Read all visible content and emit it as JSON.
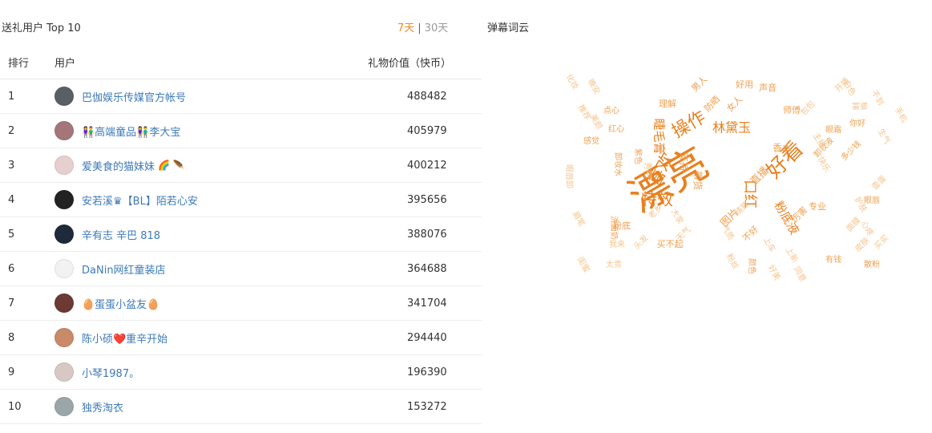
{
  "left": {
    "title": "送礼用户 Top 10",
    "tabs": [
      {
        "label": "7天",
        "active": true
      },
      {
        "label": "30天",
        "active": false
      }
    ],
    "separator": "|",
    "columns": {
      "rank": "排行",
      "user": "用户",
      "value": "礼物价值（快币）"
    },
    "rows": [
      {
        "rank": "1",
        "name": "巴伽娱乐传媒官方帐号",
        "value": "488482",
        "tail": "",
        "avatar": "#5a5f66"
      },
      {
        "rank": "2",
        "name": "👫高端童品👫李大宝",
        "value": "405979",
        "tail": "",
        "avatar": "#a4767a"
      },
      {
        "rank": "3",
        "name": "爱美食的猫妹妹",
        "value": "400212",
        "tail": "🌈 🪶",
        "avatar": "#e8cfcf"
      },
      {
        "rank": "4",
        "name": "安若溪♛【BL】陌若心安",
        "value": "395656",
        "tail": "",
        "avatar": "#222222"
      },
      {
        "rank": "5",
        "name": "辛有志 辛巴 818",
        "value": "388076",
        "tail": "",
        "avatar": "#1e2a3a"
      },
      {
        "rank": "6",
        "name": "DaNin网红童装店",
        "value": "364688",
        "tail": "",
        "avatar": "#f2f2f2"
      },
      {
        "rank": "7",
        "name": "🥚蛋蛋小盆友🥚",
        "value": "341704",
        "tail": "",
        "avatar": "#6b3a33"
      },
      {
        "rank": "8",
        "name": "陈小硕❤️重辛开始",
        "value": "294440",
        "tail": "",
        "avatar": "#c98a6a"
      },
      {
        "rank": "9",
        "name": "小琴1987。",
        "value": "196390",
        "tail": "",
        "avatar": "#d8c8c4"
      },
      {
        "rank": "10",
        "name": "独秀淘衣",
        "value": "153272",
        "tail": "",
        "avatar": "#9aa6a8"
      }
    ]
  },
  "right": {
    "title": "弹幕词云",
    "colors": {
      "strong": "#e8801f",
      "mid": "#f0a050",
      "light": "#f5c58e"
    },
    "words": [
      {
        "text": "漂亮",
        "size": 52,
        "color": "strong",
        "rotate": -30
      },
      {
        "text": "好看",
        "size": 26,
        "color": "strong",
        "rotate": -45
      },
      {
        "text": "操作",
        "size": 22,
        "color": "strong",
        "rotate": -30
      },
      {
        "text": "喜欢",
        "size": 22,
        "color": "strong",
        "rotate": -60
      },
      {
        "text": "特效",
        "size": 20,
        "color": "strong",
        "rotate": 0
      },
      {
        "text": "口红",
        "size": 18,
        "color": "strong",
        "rotate": 90
      },
      {
        "text": "林黛玉",
        "size": 16,
        "color": "strong",
        "rotate": 0
      },
      {
        "text": "睫毛膏",
        "size": 15,
        "color": "strong",
        "rotate": 90
      },
      {
        "text": "粉底液",
        "size": 15,
        "color": "strong",
        "rotate": 60
      },
      {
        "text": "直播",
        "size": 13,
        "color": "mid",
        "rotate": -45
      },
      {
        "text": "图片",
        "size": 13,
        "color": "mid",
        "rotate": -45
      },
      {
        "text": "香水",
        "size": 12,
        "color": "mid",
        "rotate": 0
      },
      {
        "text": "声音",
        "size": 11,
        "color": "mid",
        "rotate": 0
      },
      {
        "text": "好用",
        "size": 11,
        "color": "mid",
        "rotate": 0
      },
      {
        "text": "师傅",
        "size": 11,
        "color": "mid",
        "rotate": 0
      },
      {
        "text": "女人",
        "size": 11,
        "color": "mid",
        "rotate": -45
      },
      {
        "text": "男人",
        "size": 11,
        "color": "mid",
        "rotate": -45
      },
      {
        "text": "防晒",
        "size": 11,
        "color": "mid",
        "rotate": -45
      },
      {
        "text": "理解",
        "size": 11,
        "color": "mid",
        "rotate": 0
      },
      {
        "text": "支持",
        "size": 12,
        "color": "mid",
        "rotate": 90
      },
      {
        "text": "带货",
        "size": 12,
        "color": "mid",
        "rotate": 90
      },
      {
        "text": "专业",
        "size": 11,
        "color": "mid",
        "rotate": 0
      },
      {
        "text": "厉害",
        "size": 11,
        "color": "mid",
        "rotate": -45
      },
      {
        "text": "不好",
        "size": 11,
        "color": "mid",
        "rotate": -45
      },
      {
        "text": "买不起",
        "size": 11,
        "color": "mid",
        "rotate": 0
      },
      {
        "text": "粉底",
        "size": 11,
        "color": "mid",
        "rotate": 0
      },
      {
        "text": "感觉",
        "size": 10,
        "color": "mid",
        "rotate": 0
      },
      {
        "text": "红心",
        "size": 10,
        "color": "mid",
        "rotate": 0
      },
      {
        "text": "点心",
        "size": 10,
        "color": "mid",
        "rotate": 0
      },
      {
        "text": "有钱",
        "size": 10,
        "color": "mid",
        "rotate": 0
      },
      {
        "text": "散粉",
        "size": 10,
        "color": "mid",
        "rotate": 0
      },
      {
        "text": "眼霜",
        "size": 10,
        "color": "mid",
        "rotate": 0
      },
      {
        "text": "你好",
        "size": 10,
        "color": "mid",
        "rotate": 0
      },
      {
        "text": "眼唇",
        "size": 10,
        "color": "mid",
        "rotate": 0
      },
      {
        "text": "卸妆液",
        "size": 10,
        "color": "mid",
        "rotate": -45
      },
      {
        "text": "多少钱",
        "size": 10,
        "color": "mid",
        "rotate": -45
      },
      {
        "text": "卸妆水",
        "size": 10,
        "color": "mid",
        "rotate": 90
      },
      {
        "text": "洗面奶",
        "size": 10,
        "color": "mid",
        "rotate": 90
      },
      {
        "text": "紫色",
        "size": 10,
        "color": "mid",
        "rotate": 90
      },
      {
        "text": "颜色",
        "size": 10,
        "color": "mid",
        "rotate": 90
      },
      {
        "text": "秀吧",
        "size": 10,
        "color": "light",
        "rotate": 90
      },
      {
        "text": "精致",
        "size": 10,
        "color": "light",
        "rotate": -45
      },
      {
        "text": "太贵",
        "size": 10,
        "color": "light",
        "rotate": 0
      },
      {
        "text": "我来",
        "size": 10,
        "color": "light",
        "rotate": 0
      },
      {
        "text": "头发",
        "size": 10,
        "color": "light",
        "rotate": -45
      },
      {
        "text": "老乡",
        "size": 10,
        "color": "light",
        "rotate": -45
      },
      {
        "text": "天气",
        "size": 10,
        "color": "light",
        "rotate": -45
      },
      {
        "text": "包包",
        "size": 10,
        "color": "light",
        "rotate": -45
      },
      {
        "text": "开播",
        "size": 10,
        "color": "light",
        "rotate": -45
      },
      {
        "text": "白色",
        "size": 10,
        "color": "light",
        "rotate": 60
      },
      {
        "text": "不到",
        "size": 10,
        "color": "light",
        "rotate": 60
      },
      {
        "text": "富婆",
        "size": 10,
        "color": "light",
        "rotate": 0
      },
      {
        "text": "手机",
        "size": 10,
        "color": "light",
        "rotate": 60
      },
      {
        "text": "蛋蛋",
        "size": 10,
        "color": "light",
        "rotate": -45
      },
      {
        "text": "心疼",
        "size": 10,
        "color": "light",
        "rotate": 60
      },
      {
        "text": "眼唇卸",
        "size": 10,
        "color": "light",
        "rotate": 90
      },
      {
        "text": "面膜",
        "size": 10,
        "color": "light",
        "rotate": -45
      },
      {
        "text": "皮肤",
        "size": 10,
        "color": "light",
        "rotate": -45
      },
      {
        "text": "买买",
        "size": 10,
        "color": "light",
        "rotate": -45
      },
      {
        "text": "美颜",
        "size": 10,
        "color": "light",
        "rotate": 60
      },
      {
        "text": "化妆",
        "size": 10,
        "color": "light",
        "rotate": 60
      },
      {
        "text": "眉笔",
        "size": 10,
        "color": "light",
        "rotate": 60
      },
      {
        "text": "晚安",
        "size": 10,
        "color": "light",
        "rotate": 60
      },
      {
        "text": "闺蜜",
        "size": 10,
        "color": "light",
        "rotate": 60
      },
      {
        "text": "护肤",
        "size": 10,
        "color": "light",
        "rotate": 60
      },
      {
        "text": "推荐",
        "size": 10,
        "color": "light",
        "rotate": 60
      },
      {
        "text": "气质",
        "size": 10,
        "color": "light",
        "rotate": 60
      },
      {
        "text": "上车",
        "size": 10,
        "color": "light",
        "rotate": 60
      },
      {
        "text": "上新",
        "size": 10,
        "color": "light",
        "rotate": 60
      },
      {
        "text": "大家",
        "size": 10,
        "color": "light",
        "rotate": 60
      },
      {
        "text": "粉丝",
        "size": 10,
        "color": "light",
        "rotate": 60
      },
      {
        "text": "好美",
        "size": 10,
        "color": "light",
        "rotate": 60
      },
      {
        "text": "生气",
        "size": 10,
        "color": "light",
        "rotate": 60
      },
      {
        "text": "快乐",
        "size": 10,
        "color": "light",
        "rotate": 60
      },
      {
        "text": "同意",
        "size": 10,
        "color": "light",
        "rotate": 60
      },
      {
        "text": "主播",
        "size": 10,
        "color": "light",
        "rotate": 60
      }
    ]
  }
}
